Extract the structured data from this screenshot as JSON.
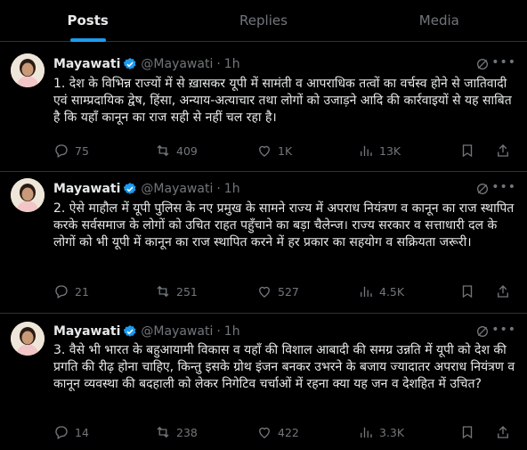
{
  "tabs": [
    {
      "label": "Posts",
      "active": true
    },
    {
      "label": "Replies",
      "active": false
    },
    {
      "label": "Media",
      "active": false
    }
  ],
  "tweets": [
    {
      "name": "Mayawati",
      "handle": "@Mayawati",
      "dot": "·",
      "time": "1h",
      "text": "1. देश के विभिन्न राज्यों में से ख़ासकर यूपी में सामंती व आपराधिक तत्वों का वर्चस्व होने से जातिवादी एवं साम्प्रदायिक द्वेष, हिंसा,  अन्याय-अत्याचार तथा लोगों को उजाड़ने आदि की कार्रवाइयों से यह साबित है कि यहाँ कानून का राज सही से नहीं चल रहा है।",
      "replies": "75",
      "reposts": "409",
      "likes": "1K",
      "views": "13K"
    },
    {
      "name": "Mayawati",
      "handle": "@Mayawati",
      "dot": "·",
      "time": "1h",
      "text": "2. ऐसे माहौल में यूपी पुलिस के नए प्रमुख के सामने राज्य में अपराध नियंत्रण व कानून का राज स्थापित करके सर्वसमाज के लोगों को उचित राहत पहुँचाने का बड़ा चैलेन्ज। राज्य सरकार व सत्ताधारी दल के लोगों को भी यूपी में कानून का राज स्थापित करने में हर प्रकार का सहयोग व सक्रियता जरूरी।",
      "replies": "21",
      "reposts": "251",
      "likes": "527",
      "views": "4.5K"
    },
    {
      "name": "Mayawati",
      "handle": "@Mayawati",
      "dot": "·",
      "time": "1h",
      "text": "3. वैसे भी भारत के बहुआयामी विकास व यहाँ की विशाल आबादी की समग्र उन्नति में यूपी को देश की प्रगति की रीढ़ होना चाहिए, किन्तु इसके ग्रोथ इंजन बनकर उभरने के बजाय ज्यादातर अपराध नियंत्रण व कानून व्यवस्था की बदहाली को लेकर निगेटिव चर्चाओं में रहना क्या यह जन व देशहित में उचित?",
      "replies": "14",
      "reposts": "238",
      "likes": "422",
      "views": "3.3K"
    }
  ],
  "icons": {
    "verified": "verified-badge-icon",
    "grok": "grok-icon",
    "more": "more-icon",
    "reply": "reply-icon",
    "repost": "repost-icon",
    "like": "like-icon",
    "views": "views-icon",
    "bookmark": "bookmark-icon",
    "share": "share-icon"
  },
  "colors": {
    "background": "#000000",
    "accent": "#1d9bf0",
    "text": "#e7e9ea",
    "muted": "#71767b",
    "divider": "#2f3336"
  }
}
